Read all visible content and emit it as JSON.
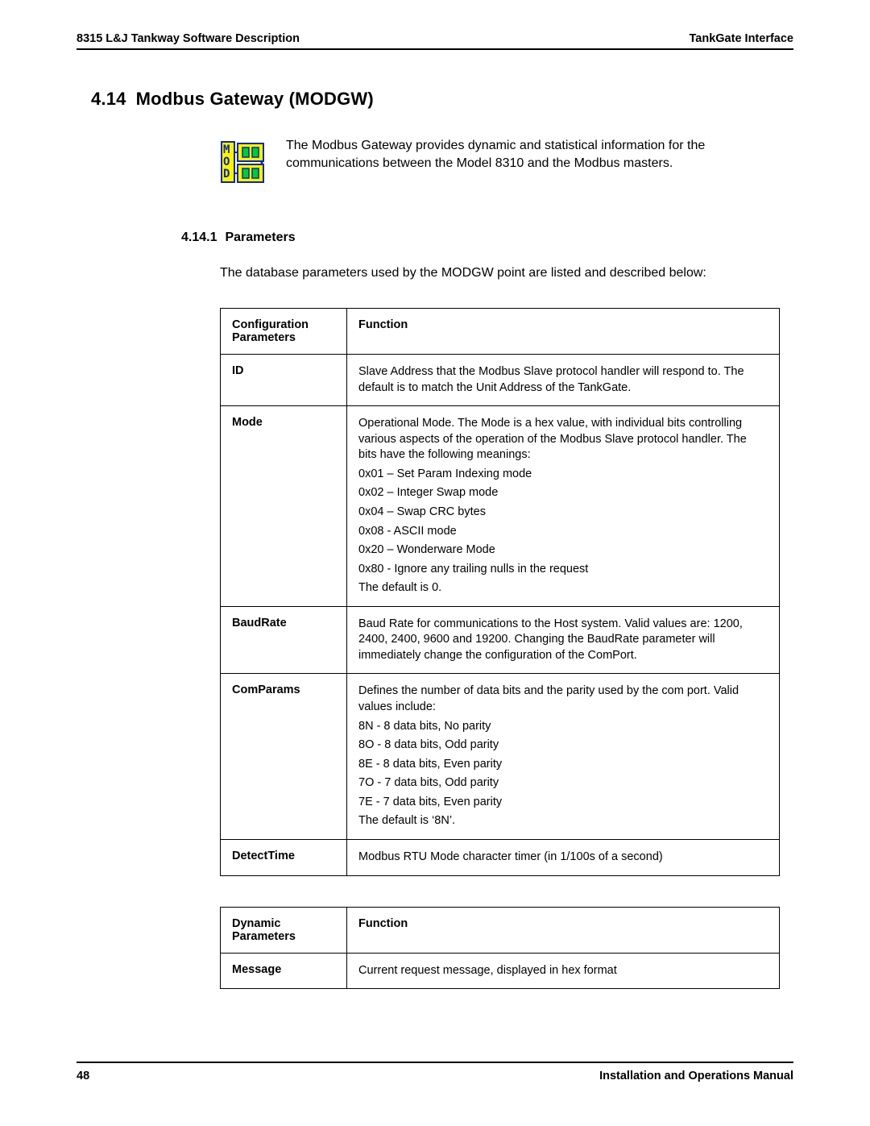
{
  "header": {
    "left": "8315 L&J Tankway Software Description",
    "right": "TankGate Interface"
  },
  "section": {
    "number": "4.14",
    "title": "Modbus Gateway (MODGW)",
    "intro": "The Modbus Gateway provides dynamic and statistical information for the communications between the Model 8310 and the Modbus masters."
  },
  "subsection": {
    "number": "4.14.1",
    "title": "Parameters",
    "intro": "The database parameters used by the MODGW point are listed and described below:"
  },
  "config_table": {
    "head_left": "Configuration Parameters",
    "head_right": "Function",
    "rows": [
      {
        "param": "ID",
        "func": [
          "Slave Address that the Modbus Slave protocol handler will respond to. The default is to match the Unit Address of the TankGate."
        ]
      },
      {
        "param": "Mode",
        "func": [
          "Operational Mode. The Mode is a hex value, with individual bits controlling various aspects of the operation of the Modbus Slave protocol handler. The bits have the following meanings:",
          "0x01 – Set Param Indexing mode",
          "0x02 – Integer Swap mode",
          "0x04 – Swap CRC bytes",
          "0x08 - ASCII mode",
          "0x20 – Wonderware Mode",
          "0x80 - Ignore any trailing nulls in the request",
          "The default is 0."
        ]
      },
      {
        "param": "BaudRate",
        "func": [
          "Baud Rate for communications to the Host system. Valid values are: 1200, 2400, 2400, 9600 and 19200. Changing the BaudRate parameter will immediately change the configuration of the ComPort."
        ]
      },
      {
        "param": "ComParams",
        "func": [
          "Defines the number of data bits and the parity used by the com port. Valid values include:",
          "8N - 8 data bits, No parity",
          "8O - 8 data bits, Odd parity",
          "8E - 8 data bits, Even parity",
          "7O - 7 data bits, Odd parity",
          "7E - 7 data bits, Even parity",
          "The default is ‘8N’."
        ]
      },
      {
        "param": "DetectTime",
        "func": [
          "Modbus RTU Mode character timer (in 1/100s of a second)"
        ]
      }
    ]
  },
  "dynamic_table": {
    "head_left": "Dynamic Parameters",
    "head_right": "Function",
    "rows": [
      {
        "param": "Message",
        "func": [
          "Current request message, displayed in hex format"
        ]
      }
    ]
  },
  "footer": {
    "page": "48",
    "right": "Installation and Operations Manual"
  },
  "icon_name": "modgw-icon"
}
